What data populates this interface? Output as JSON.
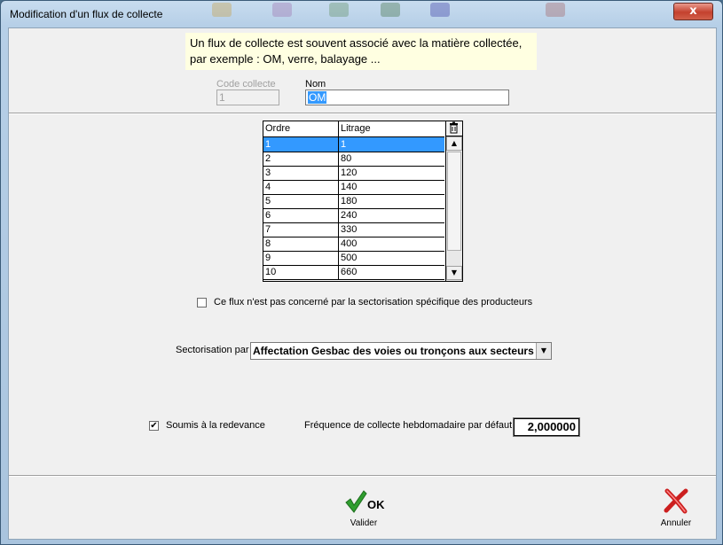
{
  "window": {
    "title": "Modification d'un flux de collecte",
    "close_glyph": "x"
  },
  "info": {
    "line1": "Un flux de collecte est souvent associé avec la matière collectée,",
    "line2": "par exemple : OM, verre, balayage ..."
  },
  "form": {
    "code_label": "Code collecte",
    "code_value": "1",
    "nom_label": "Nom",
    "nom_value": "OM"
  },
  "grid": {
    "columns": [
      "Ordre",
      "Litrage"
    ],
    "rows": [
      {
        "ordre": "1",
        "litrage": "1"
      },
      {
        "ordre": "2",
        "litrage": "80"
      },
      {
        "ordre": "3",
        "litrage": "120"
      },
      {
        "ordre": "4",
        "litrage": "140"
      },
      {
        "ordre": "5",
        "litrage": "180"
      },
      {
        "ordre": "6",
        "litrage": "240"
      },
      {
        "ordre": "7",
        "litrage": "330"
      },
      {
        "ordre": "8",
        "litrage": "400"
      },
      {
        "ordre": "9",
        "litrage": "500"
      },
      {
        "ordre": "10",
        "litrage": "660"
      }
    ],
    "selected_row": 0
  },
  "options": {
    "sectorisation_checkbox_label": "Ce flux n'est pas concerné par la sectorisation spécifique des producteurs",
    "sectorisation_checked": false,
    "sectorisation_label": "Sectorisation par",
    "sectorisation_value": "Affectation Gesbac des voies ou tronçons aux secteurs",
    "redevance_label": "Soumis à la redevance",
    "redevance_checked": true,
    "frequence_label": "Fréquence de collecte hebdomadaire par défaut",
    "frequence_value": "2,000000"
  },
  "buttons": {
    "ok_text": "OK",
    "ok_caption": "Valider",
    "cancel_caption": "Annuler"
  },
  "colors": {
    "selection": "#3399ff",
    "info_bg": "#ffffe1",
    "ok_green": "#2f9e2f",
    "cancel_red": "#cc1f1f"
  }
}
